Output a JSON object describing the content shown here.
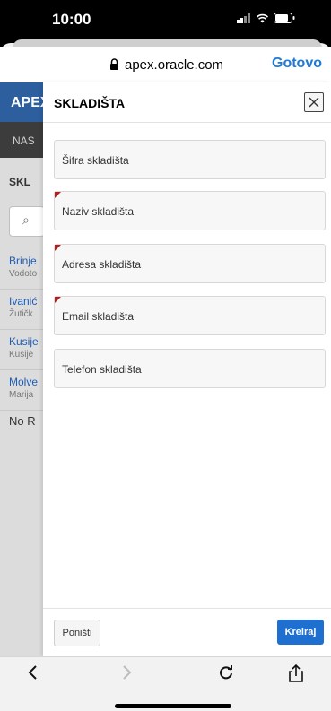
{
  "status": {
    "time": "10:00"
  },
  "browser": {
    "url": "apex.oracle.com",
    "done_label": "Gotovo"
  },
  "app": {
    "header": "APEX",
    "nav": "NAS",
    "section": "SKL",
    "list": [
      {
        "title": "Brinje",
        "subtitle": "Vodoto"
      },
      {
        "title": "Ivanić",
        "subtitle": "Žutičk"
      },
      {
        "title": "Kusije",
        "subtitle": "Kusije"
      },
      {
        "title": "Molve",
        "subtitle": "Marija"
      }
    ],
    "no_rows": "No R"
  },
  "dialog": {
    "title": "SKLADIŠTA",
    "fields": [
      {
        "label": "Šifra skladišta",
        "required": false
      },
      {
        "label": "Naziv skladišta",
        "required": true
      },
      {
        "label": "Adresa skladišta",
        "required": true
      },
      {
        "label": "Email skladišta",
        "required": true
      },
      {
        "label": "Telefon skladišta",
        "required": false
      }
    ],
    "cancel_label": "Poništi",
    "create_label": "Kreiraj"
  },
  "colors": {
    "accent": "#1f6fd1",
    "required_marker": "#b51f1f",
    "header": "#2d5f9e"
  }
}
